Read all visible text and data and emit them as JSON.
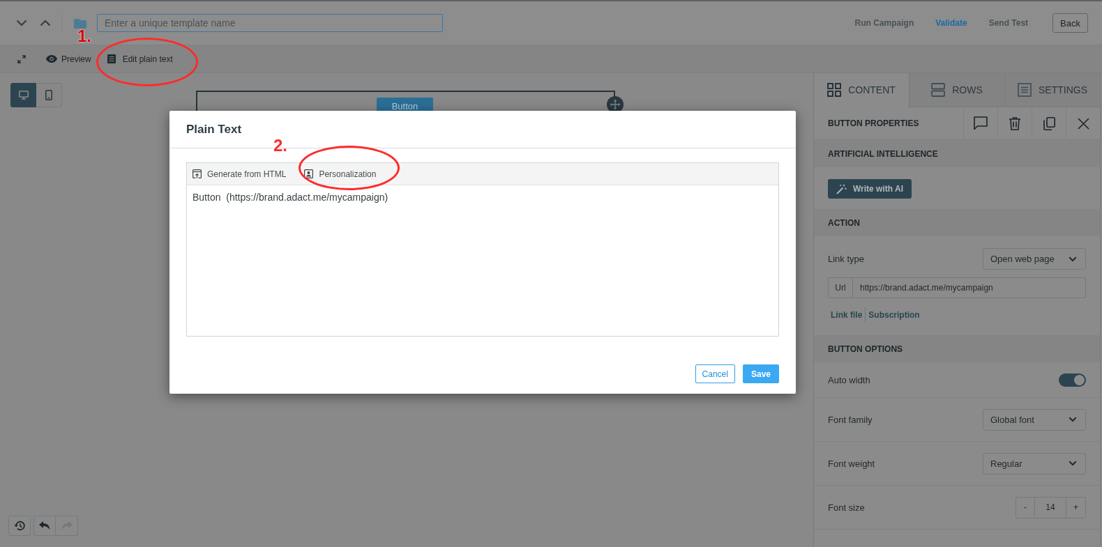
{
  "top_bar": {
    "template_name": {
      "placeholder": "Enter a unique template name"
    },
    "actions": [
      {
        "label": "Run Campaign",
        "disabled": true
      },
      {
        "label": "Validate",
        "disabled": false
      },
      {
        "label": "Send Test",
        "disabled": true
      }
    ],
    "back_button": "Back"
  },
  "editor_toolbar": {
    "items": [
      {
        "kind": "preview",
        "label": "Preview"
      },
      {
        "kind": "plain_text",
        "label": "Edit plain text"
      }
    ]
  },
  "canvas": {
    "devices": [
      {
        "kind": "desktop",
        "selected": true
      },
      {
        "kind": "mobile",
        "selected": false
      }
    ],
    "button_label": "Button",
    "history": [
      {
        "kind": "undo",
        "disabled": false
      },
      {
        "kind": "redo",
        "disabled": true
      }
    ]
  },
  "sidebar": {
    "tabs": [
      {
        "kind": "content",
        "label": "CONTENT",
        "selected": true
      },
      {
        "kind": "rows",
        "label": "ROWS",
        "selected": false
      },
      {
        "kind": "settings",
        "label": "SETTINGS",
        "selected": false
      }
    ],
    "panel_title": "BUTTON PROPERTIES",
    "sections": [
      {
        "title": "ARTIFICIAL INTELLIGENCE",
        "rows": [
          {
            "kind": "ai_button",
            "label": "Write with AI"
          }
        ]
      },
      {
        "title": "ACTION",
        "rows": [
          {
            "kind": "select",
            "label": "Link type",
            "value": "Open web page"
          },
          {
            "kind": "url",
            "label": "Url",
            "value": "https://brand.adact.me/mycampaign"
          },
          {
            "kind": "links",
            "links": [
              "Link file",
              "Subscription"
            ]
          }
        ]
      },
      {
        "title": "BUTTON OPTIONS",
        "rows": [
          {
            "kind": "toggle",
            "label": "Auto width",
            "on": true
          },
          {
            "kind": "select",
            "label": "Font family",
            "value": "Global font"
          },
          {
            "kind": "select",
            "label": "Font weight",
            "value": "Regular"
          },
          {
            "kind": "stepper",
            "label": "Font size",
            "value": "14",
            "decrement": "-",
            "increment": "+"
          }
        ]
      }
    ]
  },
  "modal": {
    "title": "Plain Text",
    "toolbar": [
      {
        "kind": "generate",
        "label": "Generate from HTML"
      },
      {
        "kind": "personalization",
        "label": "Personalization"
      }
    ],
    "text": "Button  (https://brand.adact.me/mycampaign)",
    "buttons": [
      {
        "kind": "secondary",
        "label": "Cancel"
      },
      {
        "kind": "primary",
        "label": "Save"
      }
    ]
  },
  "annotations": [
    {
      "label": "1."
    },
    {
      "label": "2."
    }
  ]
}
